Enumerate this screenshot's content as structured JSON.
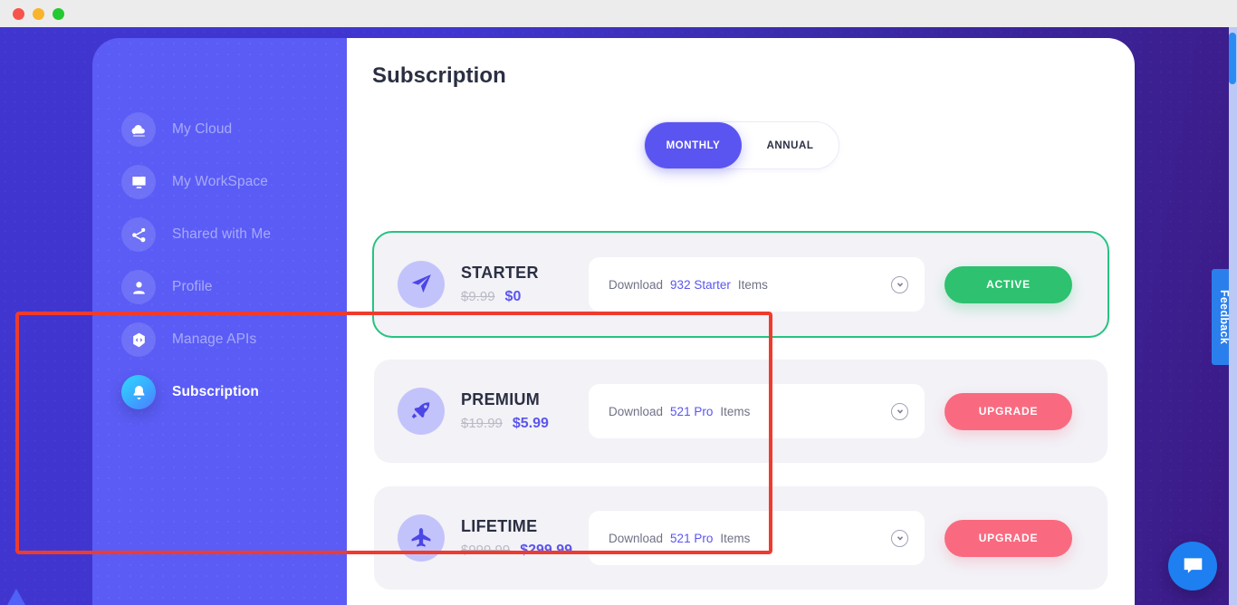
{
  "window": {
    "traffic_lights": [
      "close",
      "minimize",
      "maximize"
    ]
  },
  "sidebar": {
    "items": [
      {
        "label": "My Cloud",
        "icon": "cloud-icon",
        "active": false
      },
      {
        "label": "My WorkSpace",
        "icon": "monitor-icon",
        "active": false
      },
      {
        "label": "Shared with Me",
        "icon": "share-icon",
        "active": false
      },
      {
        "label": "Profile",
        "icon": "user-icon",
        "active": false
      },
      {
        "label": "Manage APIs",
        "icon": "api-cube-icon",
        "active": false
      },
      {
        "label": "Subscription",
        "icon": "bell-icon",
        "active": true
      }
    ]
  },
  "main": {
    "title": "Subscription",
    "billing_toggle": {
      "options": [
        "MONTHLY",
        "ANNUAL"
      ],
      "selected": "MONTHLY"
    },
    "plans": [
      {
        "name": "STARTER",
        "icon": "paper-plane-icon",
        "price_old": "$9.99",
        "price_new": "$0",
        "download_prefix": "Download",
        "download_count": "932 Starter",
        "download_suffix": "Items",
        "dropdown_icon": "chevron-down-circle-icon",
        "action_label": "ACTIVE",
        "action_type": "active",
        "highlight": "green"
      },
      {
        "name": "PREMIUM",
        "icon": "rocket-icon",
        "price_old": "$19.99",
        "price_new": "$5.99",
        "download_prefix": "Download",
        "download_count": "521 Pro",
        "download_suffix": "Items",
        "dropdown_icon": "chevron-down-circle-icon",
        "action_label": "UPGRADE",
        "action_type": "upgrade",
        "highlight": "none"
      },
      {
        "name": "LIFETIME",
        "icon": "airplane-icon",
        "price_old": "$999.99",
        "price_new": "$299.99",
        "download_prefix": "Download",
        "download_count": "521 Pro",
        "download_suffix": "Items",
        "dropdown_icon": "chevron-down-circle-icon",
        "action_label": "UPGRADE",
        "action_type": "upgrade",
        "highlight": "none"
      }
    ]
  },
  "widgets": {
    "feedback_label": "Feedback",
    "chat_icon": "chat-bubble-icon"
  },
  "colors": {
    "accent_purple": "#5a55f0",
    "sidebar_purple": "#5a5cf5",
    "active_green": "#2ec16f",
    "upgrade_pink": "#f96a80",
    "highlight_red": "#ef3b2d",
    "outline_green": "#27c281",
    "feedback_blue": "#2a7fec"
  }
}
